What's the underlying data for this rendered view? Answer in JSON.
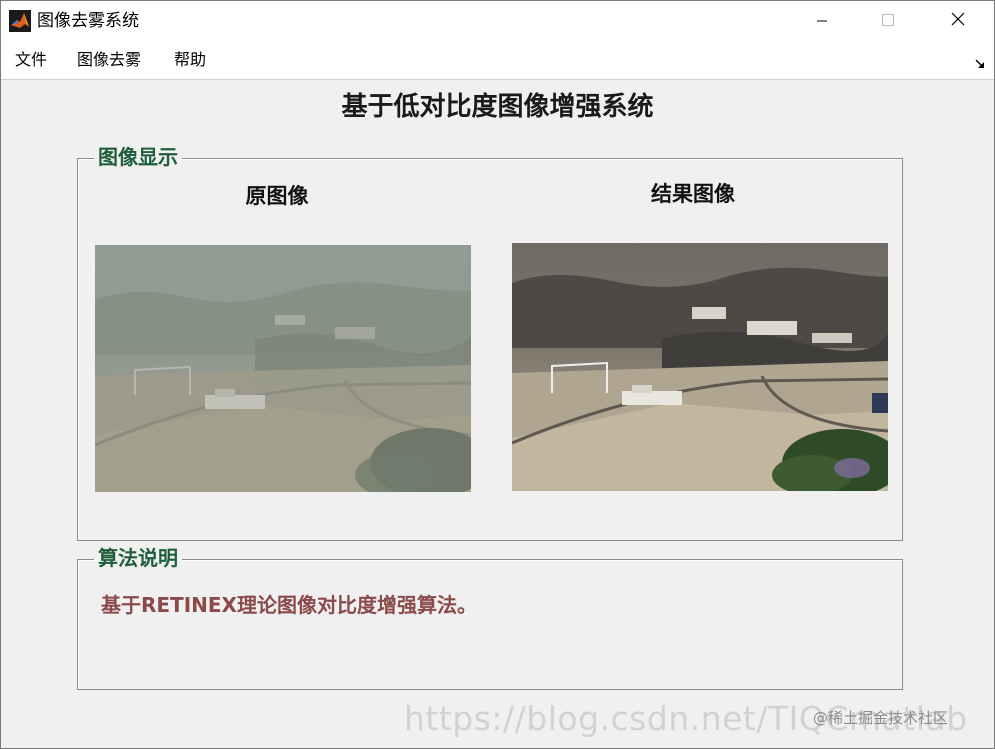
{
  "window": {
    "title": "图像去雾系统",
    "controls": {
      "minimize_icon": "minimize-icon",
      "maximize_icon": "maximize-icon",
      "close_icon": "close-icon"
    }
  },
  "menubar": {
    "items": [
      {
        "label": "文件"
      },
      {
        "label": "图像去雾"
      },
      {
        "label": "帮助"
      }
    ],
    "dock_icon": "dock-arrow-icon"
  },
  "main": {
    "title": "基于低对比度图像增强系统"
  },
  "display_panel": {
    "legend": "图像显示",
    "original_caption": "原图像",
    "result_caption": "结果图像"
  },
  "algo_panel": {
    "legend": "算法说明",
    "description": "基于RETINEX理论图像对比度增强算法。"
  },
  "watermark": {
    "url": "https://blog.csdn.net/TIQCmatlab",
    "site": "@稀土掘金技术社区"
  },
  "colors": {
    "legend_text": "#1f5e3a",
    "description_text": "#8a4a4a",
    "window_bg": "#f0f0f0"
  }
}
